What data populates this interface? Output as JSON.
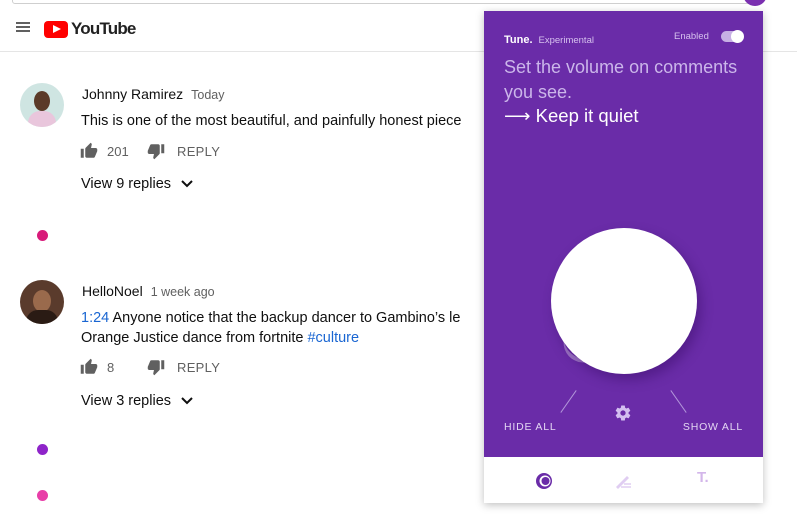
{
  "youtube": {
    "logo_text": "YouTube",
    "colors": {
      "brand_red": "#ff0000"
    }
  },
  "comments": [
    {
      "author": "Johnny Ramirez",
      "time": "Today",
      "text": "This is one of the most beautiful, and painfully honest piece",
      "likes": "201",
      "reply_label": "REPLY",
      "replies_label": "View 9 replies"
    },
    {
      "author": "HelloNoel",
      "time": "1 week ago",
      "timestamp_link": "1:24",
      "text_line1": " Anyone notice that the backup dancer to Gambino’s le",
      "text_line2": "Orange Justice dance from fortnite ",
      "hashtag": "#culture",
      "likes": "8",
      "reply_label": "REPLY",
      "replies_label": "View 3 replies"
    }
  ],
  "dots": [
    {
      "color": "#d81b7a"
    },
    {
      "color": "#8e24c9"
    },
    {
      "color": "#e83ea8"
    }
  ],
  "tune": {
    "brand": "Tune.",
    "mode": "Experimental",
    "enabled_label": "Enabled",
    "enabled": true,
    "title": "Set the volume on comments you see.",
    "setting": "⟶ Keep it quiet",
    "hide_all": "HIDE ALL",
    "show_all": "SHOW ALL",
    "icons": [
      "dial-icon",
      "gear-icon",
      "pen-icon",
      "tune-t-icon"
    ],
    "nav_t": "T.",
    "colors": {
      "panel": "#6a2ca8",
      "accent_light": "#d3b6ea"
    }
  }
}
